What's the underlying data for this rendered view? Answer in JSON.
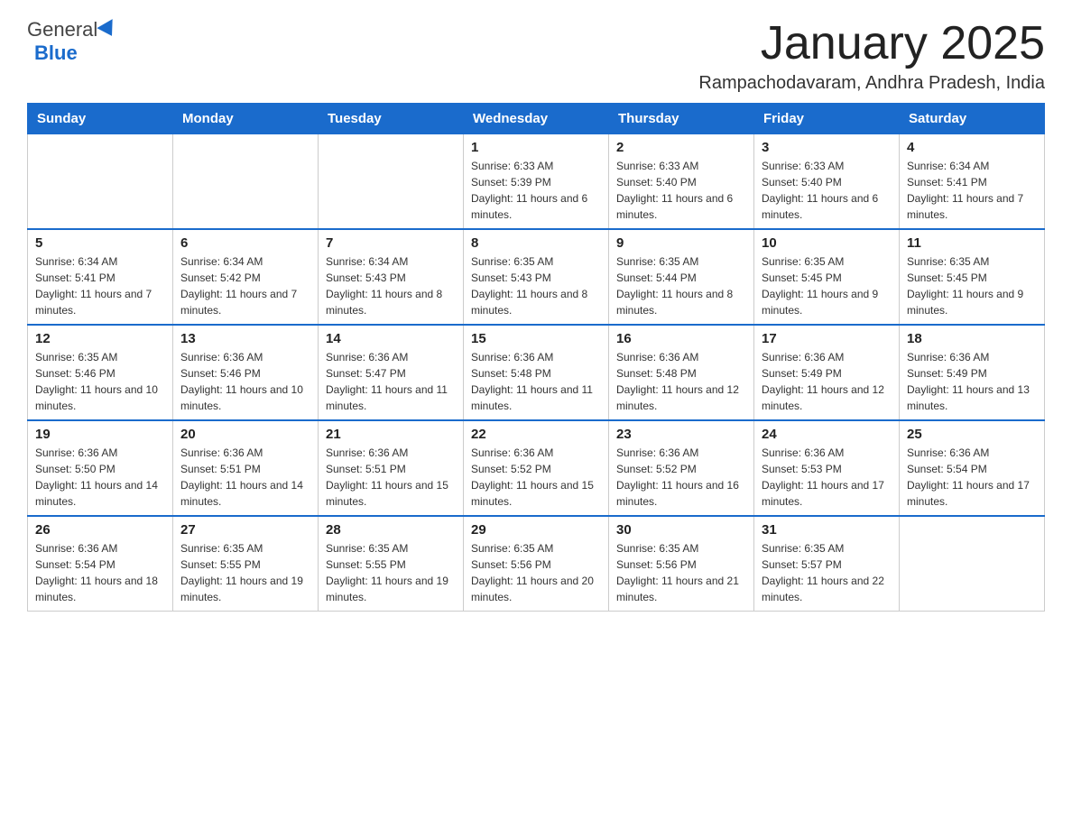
{
  "header": {
    "logo_general": "General",
    "logo_blue": "Blue",
    "month_title": "January 2025",
    "location": "Rampachodavaram, Andhra Pradesh, India"
  },
  "days_of_week": [
    "Sunday",
    "Monday",
    "Tuesday",
    "Wednesday",
    "Thursday",
    "Friday",
    "Saturday"
  ],
  "weeks": [
    [
      {
        "day": "",
        "sunrise": "",
        "sunset": "",
        "daylight": ""
      },
      {
        "day": "",
        "sunrise": "",
        "sunset": "",
        "daylight": ""
      },
      {
        "day": "",
        "sunrise": "",
        "sunset": "",
        "daylight": ""
      },
      {
        "day": "1",
        "sunrise": "Sunrise: 6:33 AM",
        "sunset": "Sunset: 5:39 PM",
        "daylight": "Daylight: 11 hours and 6 minutes."
      },
      {
        "day": "2",
        "sunrise": "Sunrise: 6:33 AM",
        "sunset": "Sunset: 5:40 PM",
        "daylight": "Daylight: 11 hours and 6 minutes."
      },
      {
        "day": "3",
        "sunrise": "Sunrise: 6:33 AM",
        "sunset": "Sunset: 5:40 PM",
        "daylight": "Daylight: 11 hours and 6 minutes."
      },
      {
        "day": "4",
        "sunrise": "Sunrise: 6:34 AM",
        "sunset": "Sunset: 5:41 PM",
        "daylight": "Daylight: 11 hours and 7 minutes."
      }
    ],
    [
      {
        "day": "5",
        "sunrise": "Sunrise: 6:34 AM",
        "sunset": "Sunset: 5:41 PM",
        "daylight": "Daylight: 11 hours and 7 minutes."
      },
      {
        "day": "6",
        "sunrise": "Sunrise: 6:34 AM",
        "sunset": "Sunset: 5:42 PM",
        "daylight": "Daylight: 11 hours and 7 minutes."
      },
      {
        "day": "7",
        "sunrise": "Sunrise: 6:34 AM",
        "sunset": "Sunset: 5:43 PM",
        "daylight": "Daylight: 11 hours and 8 minutes."
      },
      {
        "day": "8",
        "sunrise": "Sunrise: 6:35 AM",
        "sunset": "Sunset: 5:43 PM",
        "daylight": "Daylight: 11 hours and 8 minutes."
      },
      {
        "day": "9",
        "sunrise": "Sunrise: 6:35 AM",
        "sunset": "Sunset: 5:44 PM",
        "daylight": "Daylight: 11 hours and 8 minutes."
      },
      {
        "day": "10",
        "sunrise": "Sunrise: 6:35 AM",
        "sunset": "Sunset: 5:45 PM",
        "daylight": "Daylight: 11 hours and 9 minutes."
      },
      {
        "day": "11",
        "sunrise": "Sunrise: 6:35 AM",
        "sunset": "Sunset: 5:45 PM",
        "daylight": "Daylight: 11 hours and 9 minutes."
      }
    ],
    [
      {
        "day": "12",
        "sunrise": "Sunrise: 6:35 AM",
        "sunset": "Sunset: 5:46 PM",
        "daylight": "Daylight: 11 hours and 10 minutes."
      },
      {
        "day": "13",
        "sunrise": "Sunrise: 6:36 AM",
        "sunset": "Sunset: 5:46 PM",
        "daylight": "Daylight: 11 hours and 10 minutes."
      },
      {
        "day": "14",
        "sunrise": "Sunrise: 6:36 AM",
        "sunset": "Sunset: 5:47 PM",
        "daylight": "Daylight: 11 hours and 11 minutes."
      },
      {
        "day": "15",
        "sunrise": "Sunrise: 6:36 AM",
        "sunset": "Sunset: 5:48 PM",
        "daylight": "Daylight: 11 hours and 11 minutes."
      },
      {
        "day": "16",
        "sunrise": "Sunrise: 6:36 AM",
        "sunset": "Sunset: 5:48 PM",
        "daylight": "Daylight: 11 hours and 12 minutes."
      },
      {
        "day": "17",
        "sunrise": "Sunrise: 6:36 AM",
        "sunset": "Sunset: 5:49 PM",
        "daylight": "Daylight: 11 hours and 12 minutes."
      },
      {
        "day": "18",
        "sunrise": "Sunrise: 6:36 AM",
        "sunset": "Sunset: 5:49 PM",
        "daylight": "Daylight: 11 hours and 13 minutes."
      }
    ],
    [
      {
        "day": "19",
        "sunrise": "Sunrise: 6:36 AM",
        "sunset": "Sunset: 5:50 PM",
        "daylight": "Daylight: 11 hours and 14 minutes."
      },
      {
        "day": "20",
        "sunrise": "Sunrise: 6:36 AM",
        "sunset": "Sunset: 5:51 PM",
        "daylight": "Daylight: 11 hours and 14 minutes."
      },
      {
        "day": "21",
        "sunrise": "Sunrise: 6:36 AM",
        "sunset": "Sunset: 5:51 PM",
        "daylight": "Daylight: 11 hours and 15 minutes."
      },
      {
        "day": "22",
        "sunrise": "Sunrise: 6:36 AM",
        "sunset": "Sunset: 5:52 PM",
        "daylight": "Daylight: 11 hours and 15 minutes."
      },
      {
        "day": "23",
        "sunrise": "Sunrise: 6:36 AM",
        "sunset": "Sunset: 5:52 PM",
        "daylight": "Daylight: 11 hours and 16 minutes."
      },
      {
        "day": "24",
        "sunrise": "Sunrise: 6:36 AM",
        "sunset": "Sunset: 5:53 PM",
        "daylight": "Daylight: 11 hours and 17 minutes."
      },
      {
        "day": "25",
        "sunrise": "Sunrise: 6:36 AM",
        "sunset": "Sunset: 5:54 PM",
        "daylight": "Daylight: 11 hours and 17 minutes."
      }
    ],
    [
      {
        "day": "26",
        "sunrise": "Sunrise: 6:36 AM",
        "sunset": "Sunset: 5:54 PM",
        "daylight": "Daylight: 11 hours and 18 minutes."
      },
      {
        "day": "27",
        "sunrise": "Sunrise: 6:35 AM",
        "sunset": "Sunset: 5:55 PM",
        "daylight": "Daylight: 11 hours and 19 minutes."
      },
      {
        "day": "28",
        "sunrise": "Sunrise: 6:35 AM",
        "sunset": "Sunset: 5:55 PM",
        "daylight": "Daylight: 11 hours and 19 minutes."
      },
      {
        "day": "29",
        "sunrise": "Sunrise: 6:35 AM",
        "sunset": "Sunset: 5:56 PM",
        "daylight": "Daylight: 11 hours and 20 minutes."
      },
      {
        "day": "30",
        "sunrise": "Sunrise: 6:35 AM",
        "sunset": "Sunset: 5:56 PM",
        "daylight": "Daylight: 11 hours and 21 minutes."
      },
      {
        "day": "31",
        "sunrise": "Sunrise: 6:35 AM",
        "sunset": "Sunset: 5:57 PM",
        "daylight": "Daylight: 11 hours and 22 minutes."
      },
      {
        "day": "",
        "sunrise": "",
        "sunset": "",
        "daylight": ""
      }
    ]
  ]
}
